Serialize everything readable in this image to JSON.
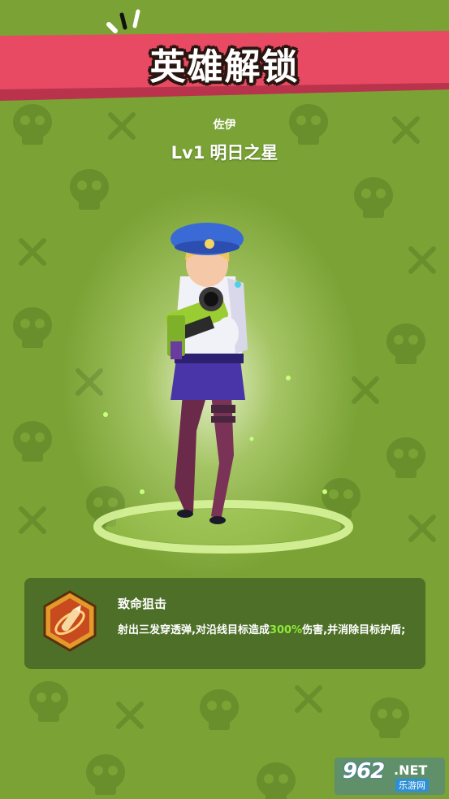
{
  "banner": {
    "title": "英雄解锁"
  },
  "hero": {
    "name": "佐伊",
    "level": "Lv1",
    "title": "明日之星"
  },
  "skill": {
    "icon": "sniper-bullet-icon",
    "name": "致命狙击",
    "desc_before": "射出三发穿透弹,对沿线目标造成",
    "desc_highlight": "300%",
    "desc_after": "伤害,并消除目标护盾;"
  },
  "watermark": {
    "number": "962",
    "net": ".NET",
    "site": "乐游网"
  },
  "colors": {
    "background": "#7aa234",
    "banner": "#e84a63",
    "highlight": "#8eea3a"
  }
}
